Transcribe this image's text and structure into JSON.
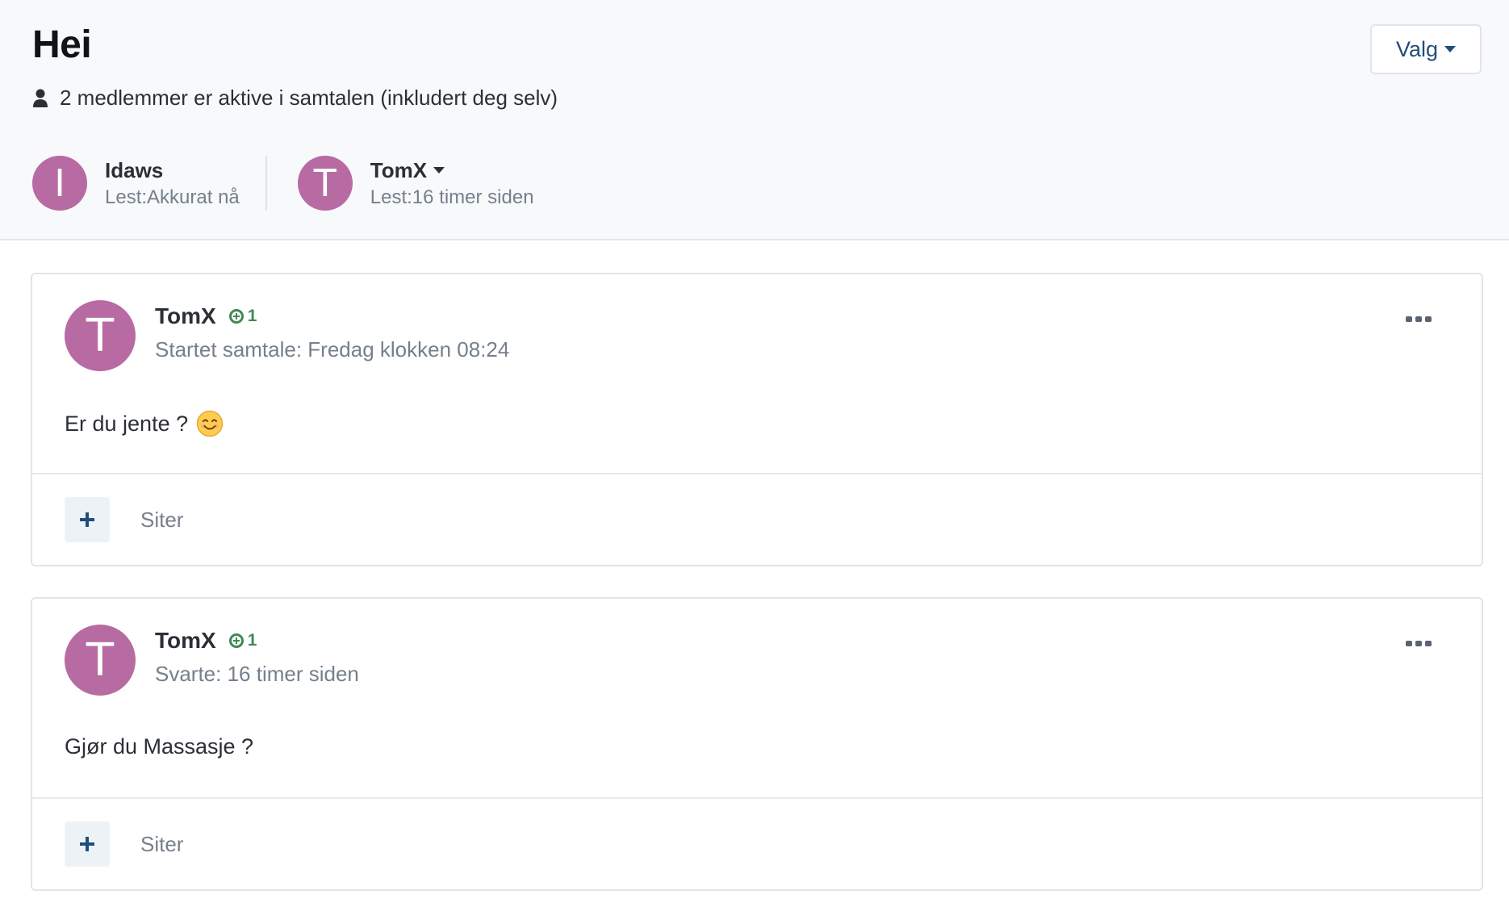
{
  "conversation": {
    "title": "Hei",
    "options_label": "Valg",
    "members_text": "2 medlemmer er aktive i samtalen (inkludert deg selv)"
  },
  "participants": [
    {
      "initial": "I",
      "name": "Idaws",
      "read": "Lest:Akkurat nå",
      "has_menu": false
    },
    {
      "initial": "T",
      "name": "TomX",
      "read": "Lest:16 timer siden",
      "has_menu": true
    }
  ],
  "posts": [
    {
      "initial": "T",
      "author": "TomX",
      "reaction_count": "1",
      "meta": "Startet samtale: Fredag klokken 08:24",
      "body": "Er du jente ?",
      "emoji": "smiling-face-icon",
      "quote_label": "Siter"
    },
    {
      "initial": "T",
      "author": "TomX",
      "reaction_count": "1",
      "meta": "Svarte: 16 timer siden",
      "body": "Gjør du Massasje ?",
      "quote_label": "Siter"
    }
  ],
  "colors": {
    "avatar": "#b86aa3",
    "reaction": "#3f8a52",
    "link": "#1f4e79",
    "muted": "#75808c"
  }
}
